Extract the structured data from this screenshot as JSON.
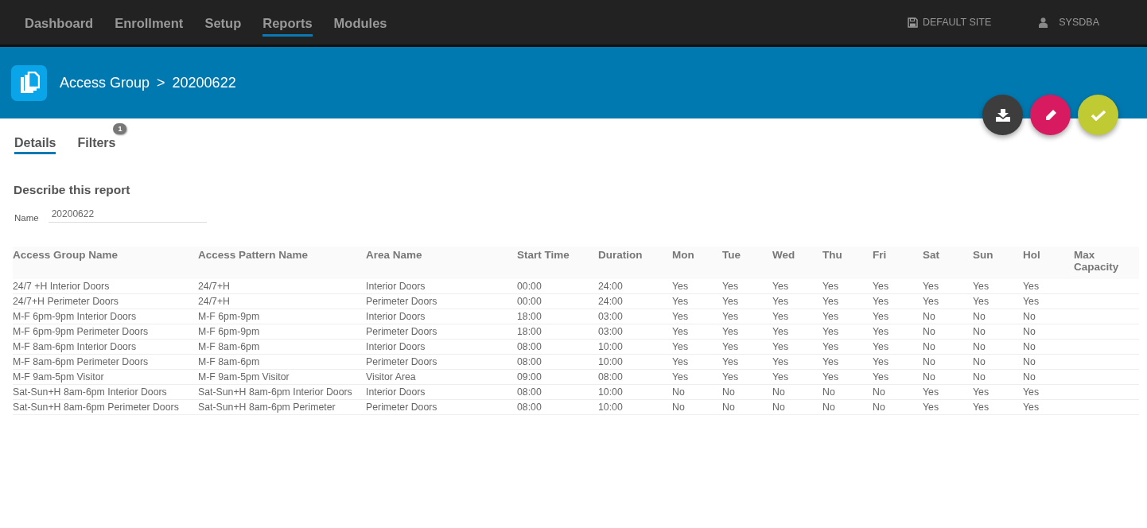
{
  "nav": {
    "items": [
      {
        "label": "Dashboard",
        "selected": false
      },
      {
        "label": "Enrollment",
        "selected": false
      },
      {
        "label": "Setup",
        "selected": false
      },
      {
        "label": "Reports",
        "selected": true
      },
      {
        "label": "Modules",
        "selected": false
      }
    ],
    "site": "DEFAULT SITE",
    "user": "SYSDBA"
  },
  "header": {
    "breadcrumb": "Access Group",
    "separator": ">",
    "title": "20200622"
  },
  "tabs": [
    {
      "label": "Details",
      "selected": true
    },
    {
      "label": "Filters",
      "selected": false,
      "badge": "1"
    }
  ],
  "form": {
    "heading": "Describe this report",
    "name_label": "Name",
    "name_value": "20200622"
  },
  "table": {
    "columns": [
      "Access Group Name",
      "Access Pattern Name",
      "Area Name",
      "Start Time",
      "Duration",
      "Mon",
      "Tue",
      "Wed",
      "Thu",
      "Fri",
      "Sat",
      "Sun",
      "Hol",
      "Max Capacity"
    ],
    "rows": [
      [
        "24/7 +H Interior Doors",
        "24/7+H",
        "Interior Doors",
        "00:00",
        "24:00",
        "Yes",
        "Yes",
        "Yes",
        "Yes",
        "Yes",
        "Yes",
        "Yes",
        "Yes"
      ],
      [
        "24/7+H Perimeter Doors",
        "24/7+H",
        "Perimeter Doors",
        "00:00",
        "24:00",
        "Yes",
        "Yes",
        "Yes",
        "Yes",
        "Yes",
        "Yes",
        "Yes",
        "Yes"
      ],
      [
        "M-F 6pm-9pm Interior Doors",
        "M-F 6pm-9pm",
        "Interior Doors",
        "18:00",
        "03:00",
        "Yes",
        "Yes",
        "Yes",
        "Yes",
        "Yes",
        "No",
        "No",
        "No"
      ],
      [
        "M-F 6pm-9pm Perimeter Doors",
        "M-F 6pm-9pm",
        "Perimeter Doors",
        "18:00",
        "03:00",
        "Yes",
        "Yes",
        "Yes",
        "Yes",
        "Yes",
        "No",
        "No",
        "No"
      ],
      [
        "M-F 8am-6pm Interior Doors",
        "M-F 8am-6pm",
        "Interior Doors",
        "08:00",
        "10:00",
        "Yes",
        "Yes",
        "Yes",
        "Yes",
        "Yes",
        "No",
        "No",
        "No"
      ],
      [
        "M-F 8am-6pm Perimeter Doors",
        "M-F 8am-6pm",
        "Perimeter Doors",
        "08:00",
        "10:00",
        "Yes",
        "Yes",
        "Yes",
        "Yes",
        "Yes",
        "No",
        "No",
        "No"
      ],
      [
        "M-F 9am-5pm Visitor",
        "M-F 9am-5pm Visitor",
        "Visitor Area",
        "09:00",
        "08:00",
        "Yes",
        "Yes",
        "Yes",
        "Yes",
        "Yes",
        "No",
        "No",
        "No"
      ],
      [
        "Sat-Sun+H 8am-6pm Interior Doors",
        "Sat-Sun+H 8am-6pm Interior Doors",
        "Interior Doors",
        "08:00",
        "10:00",
        "No",
        "No",
        "No",
        "No",
        "No",
        "Yes",
        "Yes",
        "Yes"
      ],
      [
        "Sat-Sun+H 8am-6pm Perimeter Doors",
        "Sat-Sun+H 8am-6pm Perimeter",
        "Perimeter Doors",
        "08:00",
        "10:00",
        "No",
        "No",
        "No",
        "No",
        "No",
        "Yes",
        "Yes",
        "Yes"
      ]
    ]
  }
}
